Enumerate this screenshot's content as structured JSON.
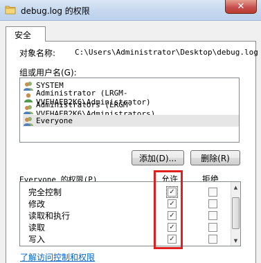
{
  "window": {
    "title": "debug.log 的权限",
    "close_glyph": "✕"
  },
  "tabs": [
    {
      "label": "安全"
    }
  ],
  "object": {
    "label": "对象名称:",
    "value": "C:\\Users\\Administrator\\Desktop\\debug.log"
  },
  "users": {
    "label": "组或用户名(G):",
    "items": [
      {
        "name": "SYSTEM",
        "icon": "user-group-icon"
      },
      {
        "name": "Administrator (LRGM-VVFHAEB2K6\\Administrator)",
        "icon": "user-icon"
      },
      {
        "name": "Administrators (LRGM-VVFHAEB2K6\\Administrators)",
        "icon": "user-group-icon"
      },
      {
        "name": "Everyone",
        "icon": "user-group-icon",
        "selected": true
      }
    ]
  },
  "buttons": {
    "add": "添加(D)...",
    "remove": "删除(R)"
  },
  "permissions": {
    "title": "Everyone 的权限(P)",
    "allow_header": "允许",
    "deny_header": "拒绝",
    "rows": [
      {
        "name": "完全控制",
        "allow": true,
        "deny": false
      },
      {
        "name": "修改",
        "allow": true,
        "deny": false
      },
      {
        "name": "读取和执行",
        "allow": true,
        "deny": false
      },
      {
        "name": "读取",
        "allow": true,
        "deny": false
      },
      {
        "name": "写入",
        "allow": true,
        "deny": false
      }
    ],
    "check_glyph": "✓"
  },
  "footer": {
    "link": "了解访问控制和权限"
  },
  "colors": {
    "highlight_border": "#e02020",
    "link": "#0066cc"
  }
}
